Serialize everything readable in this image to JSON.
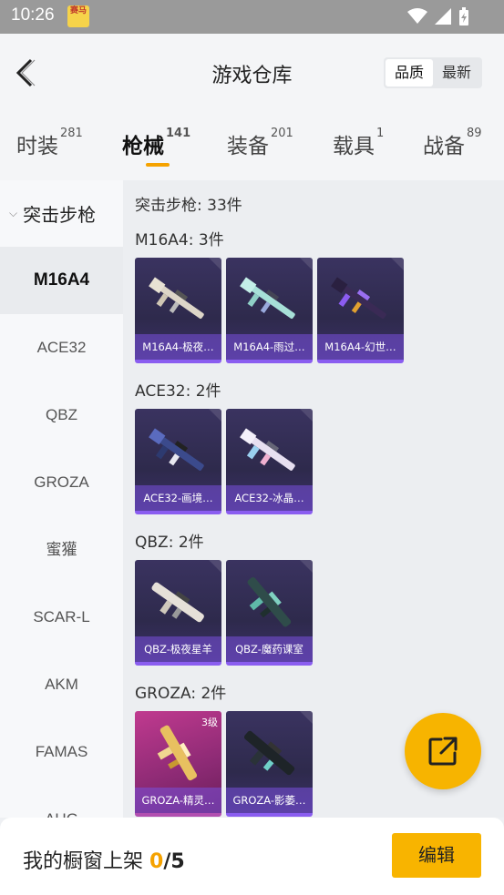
{
  "status_bar": {
    "time": "10:26",
    "app_badge": "赛马"
  },
  "header": {
    "title": "游戏仓库",
    "sort_options": [
      "品质",
      "最新"
    ],
    "sort_active": "品质"
  },
  "tabs": [
    {
      "label": "时装",
      "count": "281"
    },
    {
      "label": "枪械",
      "count": "141"
    },
    {
      "label": "装备",
      "count": "201"
    },
    {
      "label": "载具",
      "count": "1"
    },
    {
      "label": "战备",
      "count": "89"
    }
  ],
  "sidebar": {
    "group": "突击步枪",
    "items": [
      "M16A4",
      "ACE32",
      "QBZ",
      "GROZA",
      "蜜獾",
      "SCAR-L",
      "AKM",
      "FAMAS",
      "AUG"
    ]
  },
  "content": {
    "category_title": "突击步枪: 33件",
    "sections": [
      {
        "title": "M16A4: 3件",
        "items": [
          "M16A4-极夜…",
          "M16A4-雨过…",
          "M16A4-幻世…"
        ]
      },
      {
        "title": "ACE32: 2件",
        "items": [
          "ACE32-画境…",
          "ACE32-冰晶…"
        ]
      },
      {
        "title": "QBZ: 2件",
        "items": [
          "QBZ-极夜星羊",
          "QBZ-魔药课室"
        ]
      },
      {
        "title": "GROZA: 2件",
        "items": [
          "GROZA-精灵…",
          "GROZA-影萎…"
        ],
        "levels": [
          "3级",
          ""
        ]
      }
    ]
  },
  "bottom_bar": {
    "shelf_label": "我的橱窗上架",
    "shelf_count": "0",
    "shelf_total": "/5",
    "edit_label": "编辑"
  },
  "colors": {
    "accent": "#f5a200",
    "card_border": "#8a5df0",
    "fab": "#f7b400"
  }
}
